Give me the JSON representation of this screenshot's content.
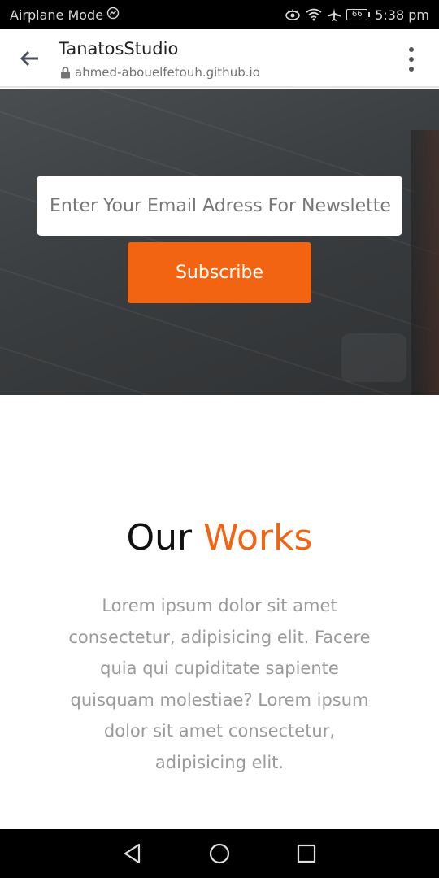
{
  "status_bar": {
    "left_text": "Airplane Mode",
    "battery_level": "66",
    "time": "5:38 pm"
  },
  "browser": {
    "title": "TanatosStudio",
    "url": "ahmed-abouelfetouh.github.io"
  },
  "newsletter": {
    "email_placeholder": "Enter Your Email Adress For Newsletter",
    "subscribe_label": "Subscribe"
  },
  "works": {
    "title_part1": "Our",
    "title_part2": "Works",
    "description": "Lorem ipsum dolor sit amet consectetur, adipisicing elit. Facere quia qui cupiditate sapiente quisquam molestiae? Lorem ipsum dolor sit amet consectetur, adipisicing elit."
  },
  "colors": {
    "accent": "#f26411",
    "status_bg": "#000000",
    "hero_bg": "#3f4244"
  },
  "icons": [
    "messenger-icon",
    "eye-comfort-icon",
    "wifi-icon",
    "airplane-icon",
    "battery-icon",
    "back-arrow-icon",
    "lock-icon",
    "more-vert-icon",
    "nav-back-icon",
    "nav-home-icon",
    "nav-recents-icon"
  ]
}
